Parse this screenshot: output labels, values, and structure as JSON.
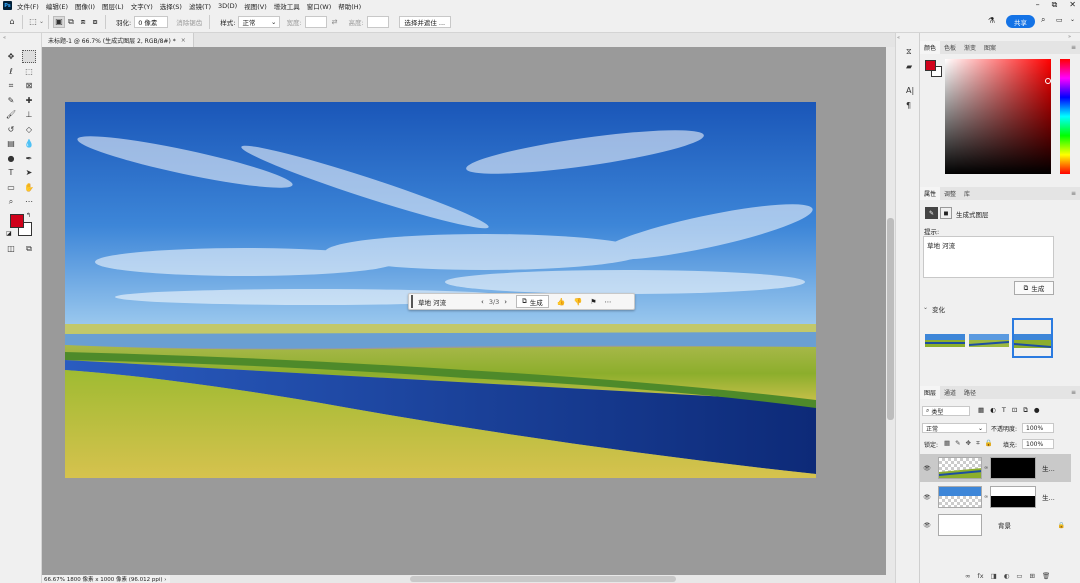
{
  "menubar": {
    "logo": "Ps",
    "items": [
      "文件(F)",
      "编辑(E)",
      "图像(I)",
      "图层(L)",
      "文字(Y)",
      "选择(S)",
      "滤镜(T)",
      "3D(D)",
      "视图(V)",
      "增效工具",
      "窗口(W)",
      "帮助(H)"
    ],
    "window_controls": [
      "–",
      "⧉",
      "✕"
    ]
  },
  "options": {
    "feather_label": "羽化:",
    "feather_value": "0 像素",
    "antialias_label": "消除锯齿",
    "style_label": "样式:",
    "style_value": "正常",
    "width_label": "宽度:",
    "height_label": "高度:",
    "select_subject": "选择并遮住 ...",
    "share_label": "共享"
  },
  "document": {
    "tab_title": "未标题-1 @ 66.7% (生成式图层 2, RGB/8#) *",
    "tab_close": "×",
    "status": "66.67%  1800 像素 x 1000 像素 (96.012 ppi)  ›"
  },
  "context_bar": {
    "prompt": "草地 河流",
    "page_counter": "3/3",
    "prev": "‹",
    "next": "›",
    "generate_label": "生成"
  },
  "color_panel": {
    "tabs": [
      "颜色",
      "色板",
      "渐变",
      "图案"
    ],
    "foreground": "#d0021b",
    "background": "#ffffff"
  },
  "properties_panel": {
    "tabs": [
      "属性",
      "调整",
      "库"
    ],
    "layer_type": "生成式图层",
    "prompt_label": "提示:",
    "prompt_text": "草地 河流",
    "generate_label": "生成",
    "variations_label": "变化"
  },
  "layers_panel": {
    "tabs": [
      "图层",
      "通道",
      "路径"
    ],
    "filter_label": "类型",
    "blend_mode": "正常",
    "opacity_label": "不透明度:",
    "opacity_value": "100%",
    "lock_label": "锁定:",
    "fill_label": "填充:",
    "fill_value": "100%",
    "layers": [
      {
        "name": "生...",
        "selected": true
      },
      {
        "name": "生...",
        "selected": false
      },
      {
        "name": "背景",
        "selected": false
      }
    ],
    "footer_icons": [
      "link-icon",
      "fx-icon",
      "mask-icon",
      "adjustment-icon",
      "folder-icon",
      "new-layer-icon",
      "trash-icon"
    ]
  }
}
